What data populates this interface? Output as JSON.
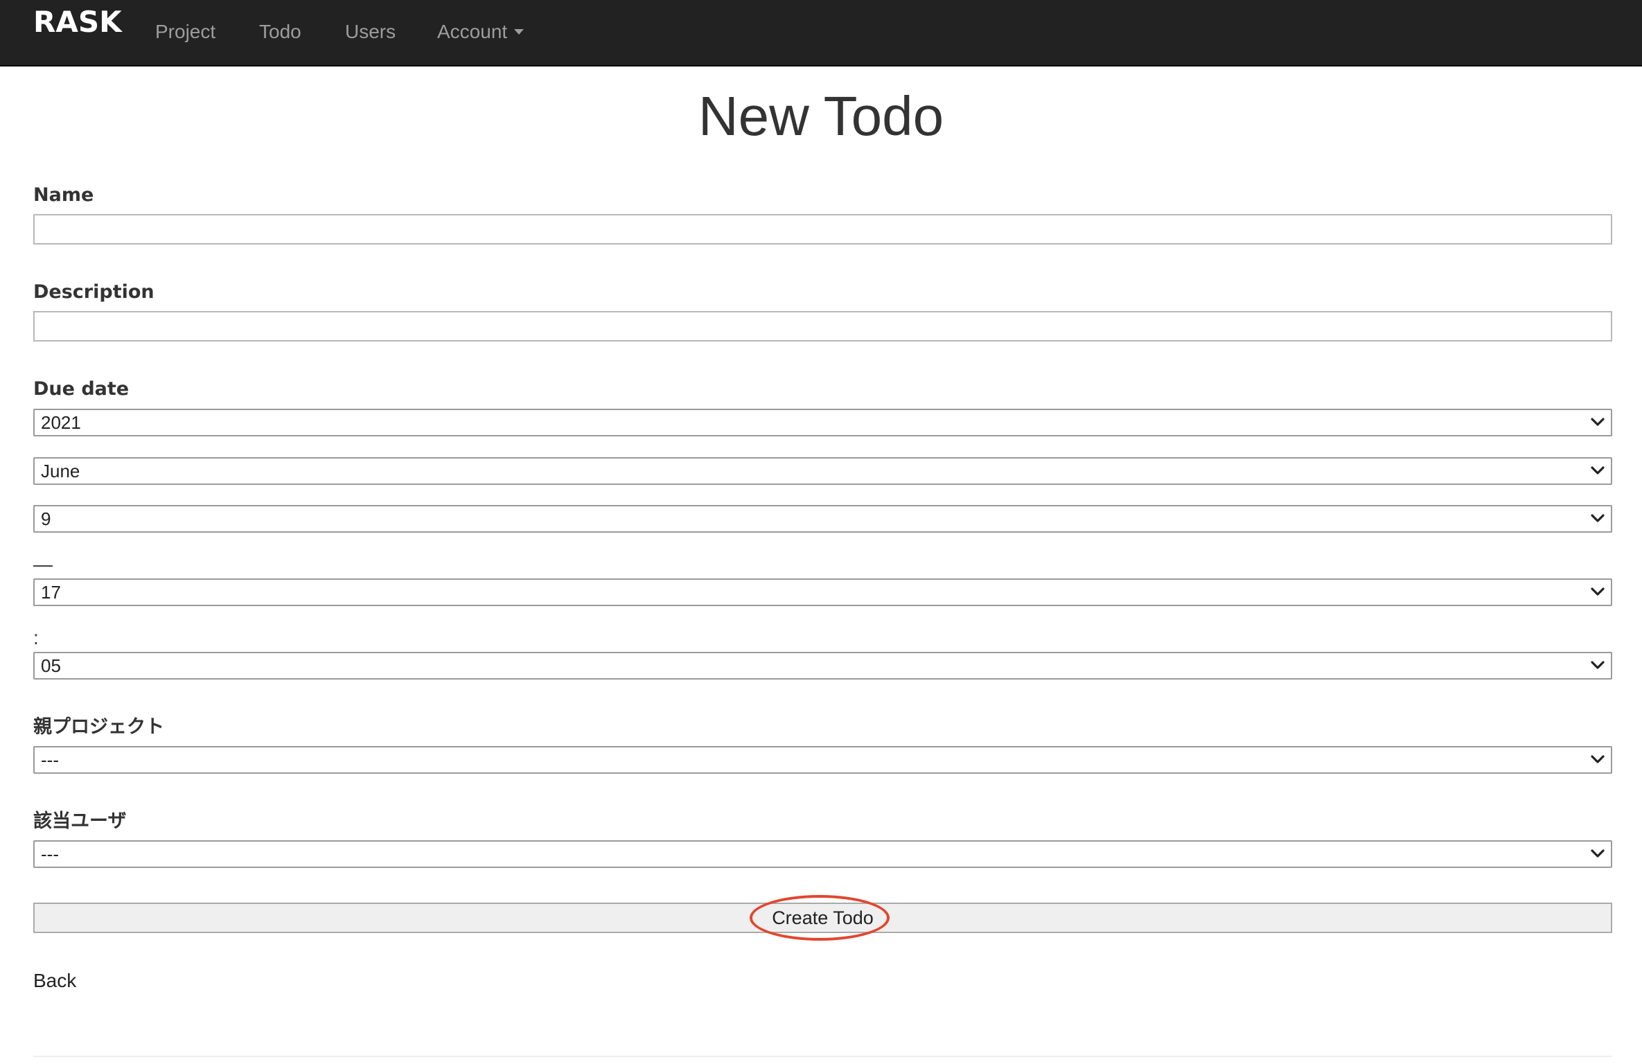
{
  "navbar": {
    "brand": "RASK",
    "links": [
      "Project",
      "Todo",
      "Users"
    ],
    "account_label": "Account"
  },
  "page": {
    "title": "New Todo"
  },
  "form": {
    "name_label": "Name",
    "name_value": "",
    "description_label": "Description",
    "description_value": "",
    "due_date_label": "Due date",
    "year_value": "2021",
    "month_value": "June",
    "day_value": "9",
    "date_time_separator": "—",
    "hour_value": "17",
    "time_separator": ":",
    "minute_value": "05",
    "parent_project_label": "親プロジェクト",
    "parent_project_value": "---",
    "assigned_user_label": "該当ユーザ",
    "assigned_user_value": "---",
    "submit_label": "Create Todo"
  },
  "back_label": "Back",
  "colors": {
    "navbar_bg": "#222222",
    "nav_link": "#9d9d9d",
    "annotation": "#e2462f"
  },
  "icons": {
    "account_dropdown": "caret-down-icon",
    "select_arrow": "chevron-down-icon"
  }
}
